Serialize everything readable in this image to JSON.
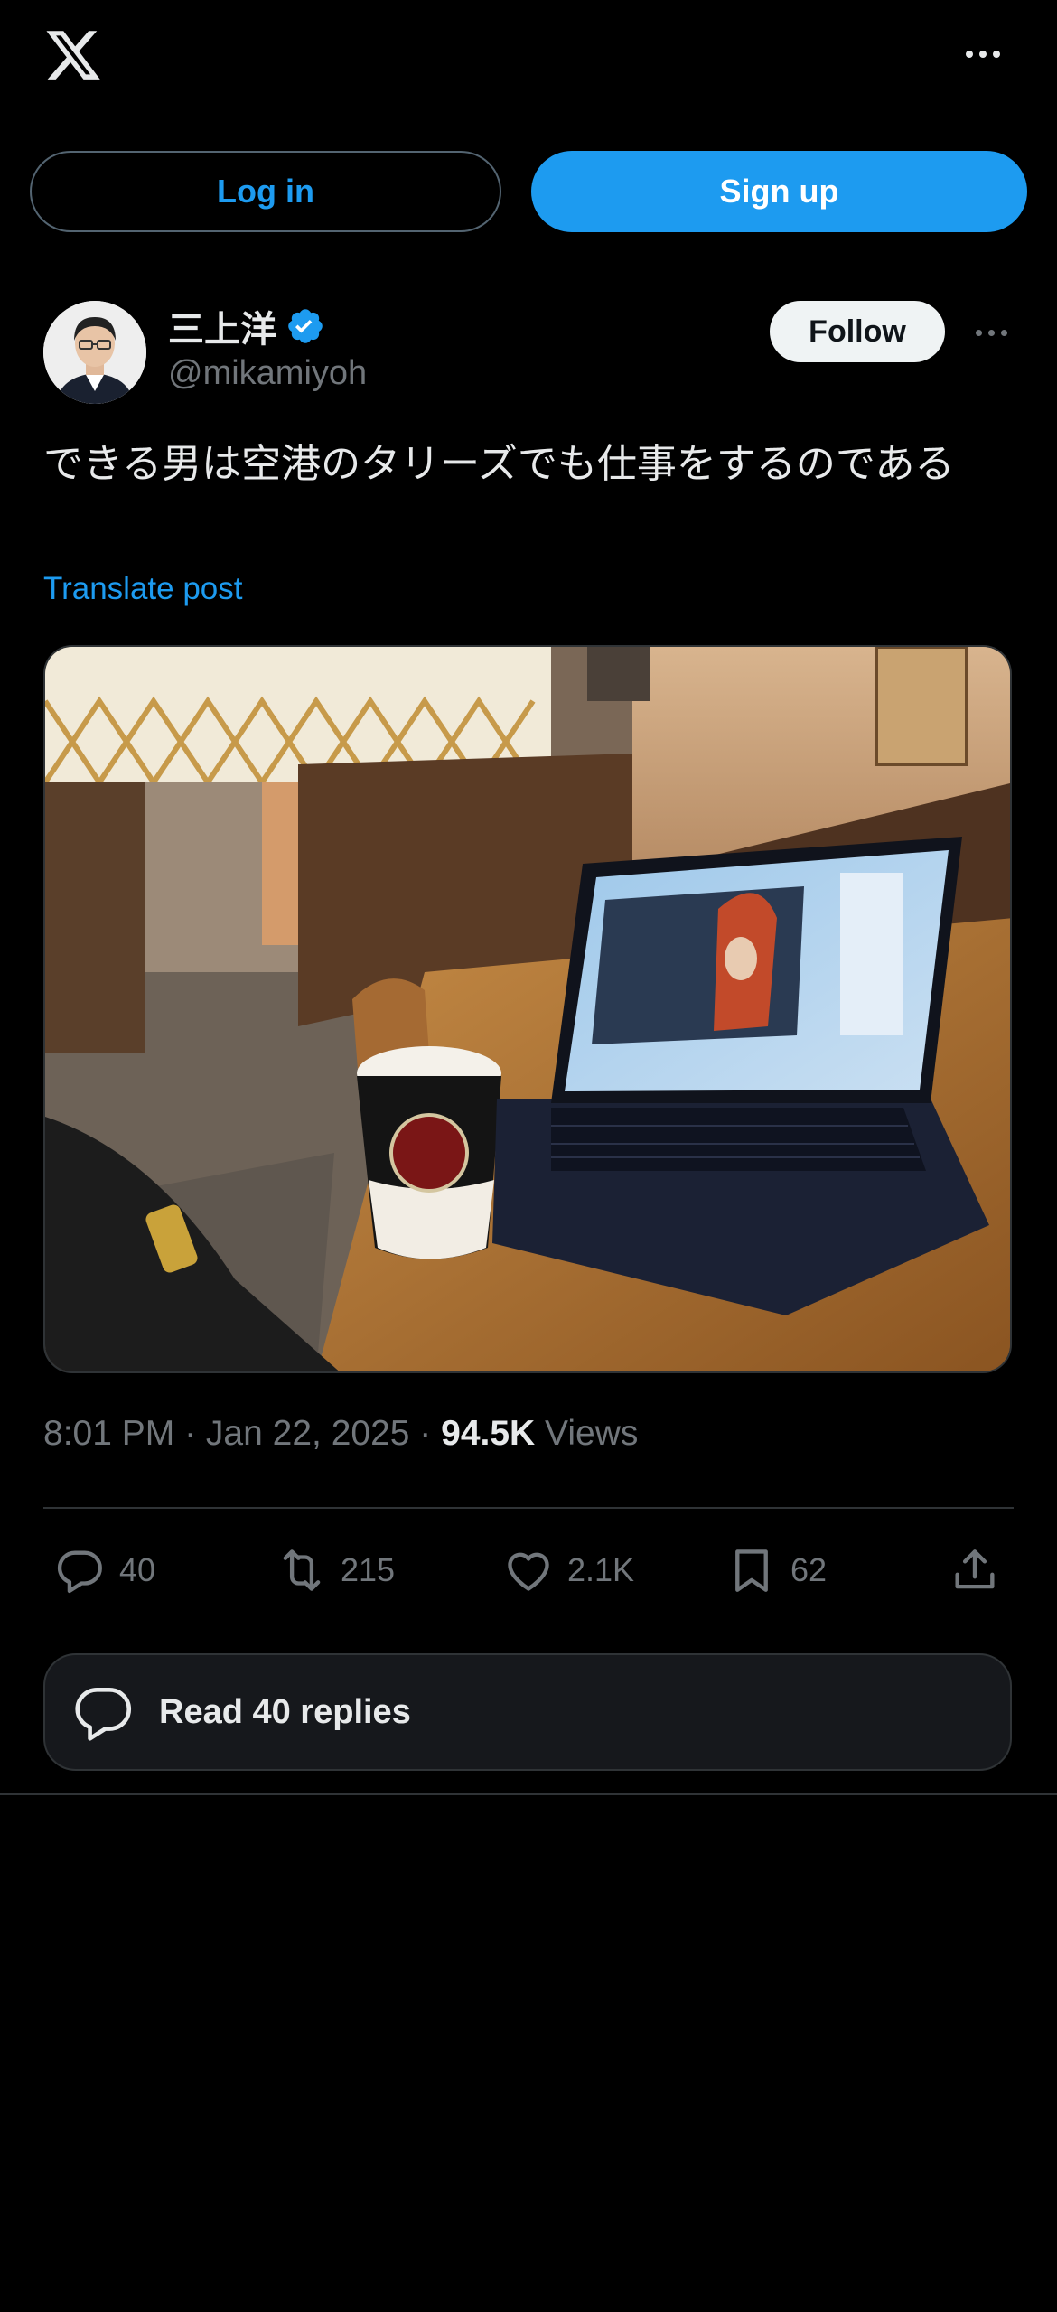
{
  "header": {
    "logo_icon": "x-logo-icon",
    "more_icon": "more-horizontal-icon"
  },
  "auth": {
    "login_label": "Log in",
    "signup_label": "Sign up"
  },
  "author": {
    "display_name": "三上洋",
    "handle": "@mikamiyoh",
    "verified_icon": "verified-badge-icon",
    "follow_label": "Follow"
  },
  "post": {
    "text": "できる男は空港のタリーズでも仕事をするのである",
    "translate_label": "Translate post",
    "image_icon": "photo-laptop-coffee-cafe",
    "time": "8:01 PM",
    "date": "Jan 22, 2025",
    "views_count": "94.5K",
    "views_label": "Views",
    "separator": " · "
  },
  "actions": {
    "replies": "40",
    "reposts": "215",
    "likes": "2.1K",
    "bookmarks": "62"
  },
  "read_replies_label": "Read 40 replies",
  "colors": {
    "accent": "#1d9bf0",
    "background": "#000000",
    "muted": "#71767b",
    "border": "#2f3336"
  }
}
